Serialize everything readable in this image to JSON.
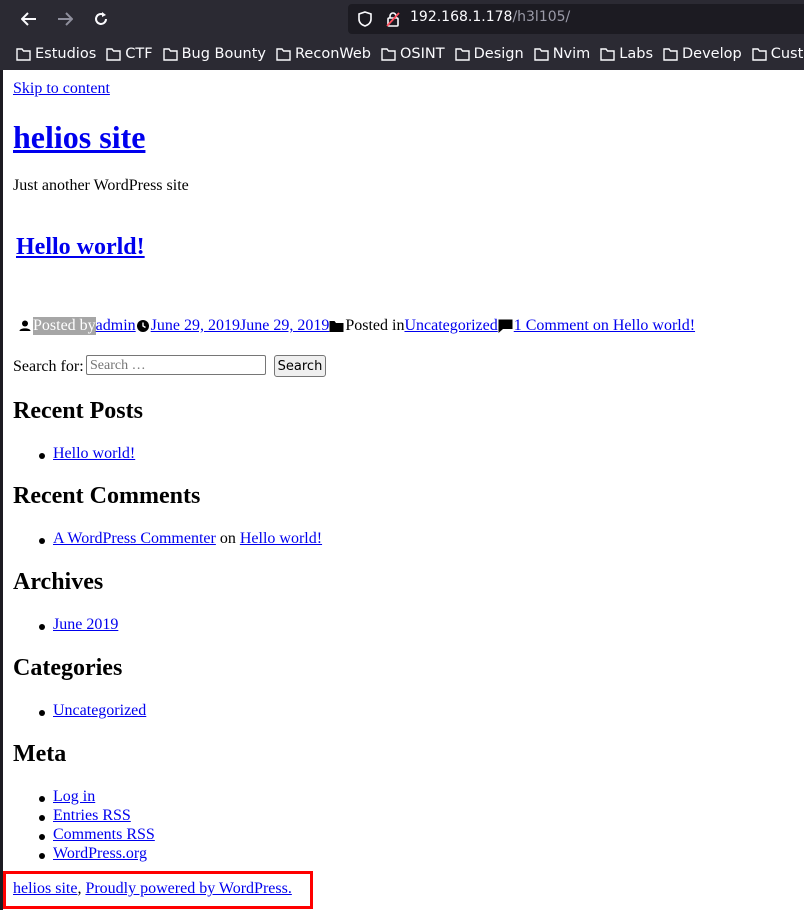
{
  "browser": {
    "url_host": "192.168.1.178",
    "url_path": "/h3l105/",
    "bookmarks": [
      "Estudios",
      "CTF",
      "Bug Bounty",
      "ReconWeb",
      "OSINT",
      "Design",
      "Nvim",
      "Labs",
      "Develop",
      "Custom"
    ]
  },
  "site": {
    "skip_link": "Skip to content",
    "title": "helios site",
    "tagline": "Just another WordPress site"
  },
  "post": {
    "title": "Hello world!",
    "posted_by_label": "Posted by",
    "author": "admin",
    "date": "June 29, 2019June 29, 2019",
    "posted_in_label": "Posted in",
    "category": "Uncategorized",
    "comments": "1 Comment on Hello world!"
  },
  "search": {
    "label": "Search for:",
    "placeholder": "Search …",
    "button": "Search"
  },
  "widgets": {
    "recent_posts": {
      "title": "Recent Posts",
      "items": [
        "Hello world!"
      ]
    },
    "recent_comments": {
      "title": "Recent Comments",
      "author": "A WordPress Commenter",
      "on": "on",
      "post": "Hello world!"
    },
    "archives": {
      "title": "Archives",
      "items": [
        "June 2019"
      ]
    },
    "categories": {
      "title": "Categories",
      "items": [
        "Uncategorized"
      ]
    },
    "meta": {
      "title": "Meta",
      "items": [
        "Log in",
        "Entries RSS",
        "Comments RSS",
        "WordPress.org"
      ]
    }
  },
  "footer": {
    "site_link": "helios site",
    "separator": ",",
    "powered": "Proudly powered by WordPress."
  }
}
